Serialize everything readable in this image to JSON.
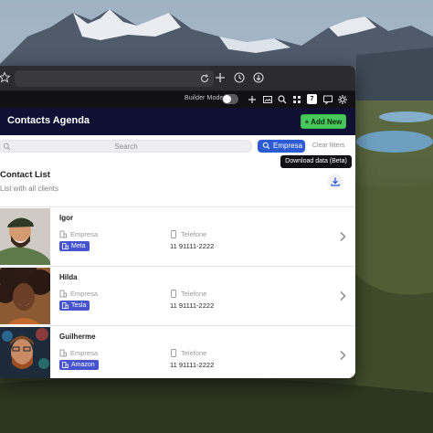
{
  "browser": {
    "toolbar_icons": [
      "star-icon",
      "reload-icon",
      "plus-icon",
      "history-icon",
      "download-circle-icon"
    ]
  },
  "builder_bar": {
    "label": "Builder Mode",
    "toggle_on": false,
    "calendar_badge": "7",
    "icons": [
      "plus-icon",
      "image-icon",
      "search-icon",
      "grid-icon",
      "calendar-icon",
      "chat-icon",
      "gear-icon"
    ]
  },
  "header": {
    "title": "Contacts Agenda",
    "add_button": "+ Add New",
    "accent_color": "#48c85a",
    "background_color": "#0e1133"
  },
  "search": {
    "placeholder": "Search",
    "filter_chip": "Empresa",
    "clear_label": "Clear filters",
    "tooltip": "Download data (Beta)"
  },
  "list": {
    "title": "Contact List",
    "subtitle": "List with all clients",
    "company_label": "Empresa",
    "phone_label": "Telefone",
    "contacts": [
      {
        "name": "Igor",
        "company": "Meta",
        "phone": "11 91111-2222",
        "tag_color": "#4654cf"
      },
      {
        "name": "Hilda",
        "company": "Tesla",
        "phone": "11 91111-2222",
        "tag_color": "#4654cf"
      },
      {
        "name": "Guilherme",
        "company": "Amazon",
        "phone": "11 91111-2222",
        "tag_color": "#4654cf"
      }
    ]
  }
}
